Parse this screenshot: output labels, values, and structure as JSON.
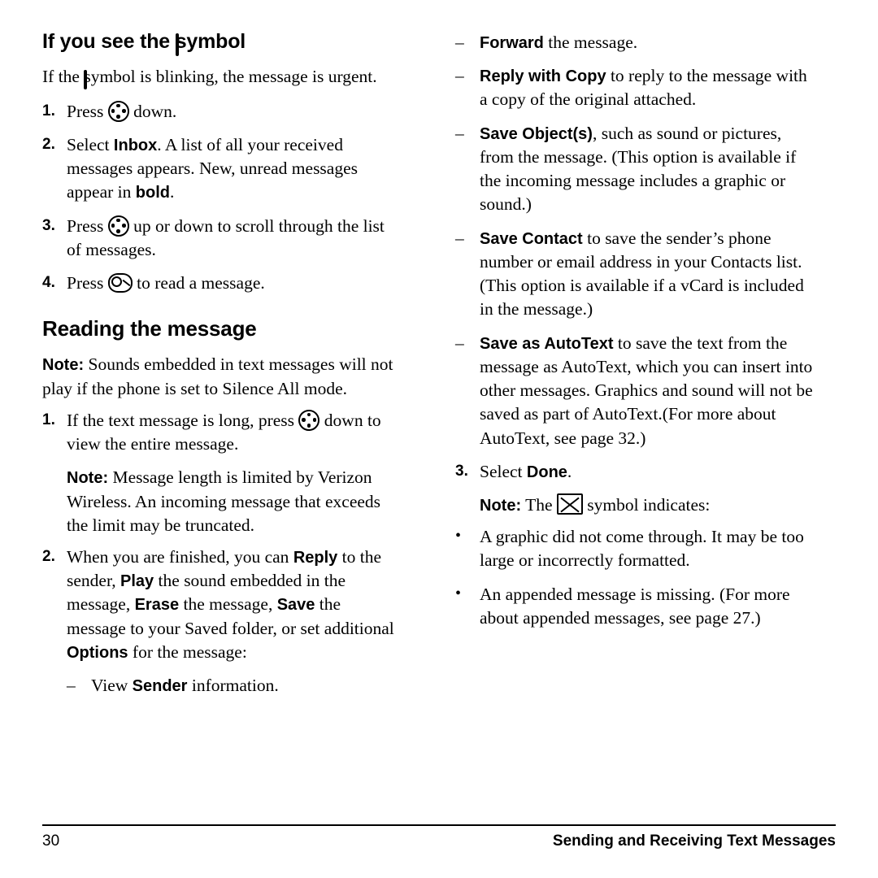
{
  "left": {
    "heading_pre": "If you see the",
    "heading_post": "symbol",
    "intro_pre": "If the",
    "intro_post": "symbol is blinking, the message is urgent.",
    "steps": [
      {
        "num": "1.",
        "pre": "Press",
        "post": "down."
      },
      {
        "num": "2.",
        "pre": "Select",
        "bold": "Inbox",
        "post": ". A list of all your received messages appears. New, unread messages appear in ",
        "bold2": "bold",
        "post2": "."
      },
      {
        "num": "3.",
        "pre": "Press",
        "post": "up or down to scroll through the list of messages."
      },
      {
        "num": "4.",
        "pre": "Press",
        "post": "to read a message."
      }
    ],
    "section2_heading": "Reading the message",
    "note1_label": "Note:",
    "note1_text": "Sounds embedded in text messages will not play if the phone is set to Silence All mode.",
    "step1_pre": "If the text message is long, press",
    "step1_post": "down to view the entire message.",
    "note2_label": "Note:",
    "note2_text": "Message length is limited by Verizon Wireless. An incoming message that exceeds the limit may be truncated.",
    "step2_num": "2.",
    "step2_a": "When you are finished, you can ",
    "step2_b_bold": "Reply",
    "step2_c": " to the sender, ",
    "step2_d_bold": "Play",
    "step2_e": " the sound embedded in the message, ",
    "step2_f_bold": "Erase",
    "step2_g": " the message, ",
    "step2_h_bold": "Save",
    "step2_i": " the message to your Saved folder, or set additional ",
    "step2_j_bold": "Options",
    "step2_k": " for the message:",
    "dash1_bold": "",
    "dash1_a": "View ",
    "dash1_b_bold": "Sender",
    "dash1_c": " information."
  },
  "right": {
    "dashes": [
      {
        "bold": "Forward",
        "text": " the message."
      },
      {
        "bold": "Reply with Copy",
        "text": " to reply to the message with a copy of the original attached."
      },
      {
        "bold": "Save Object(s)",
        "text": ", such as sound or pictures, from the message. (This option is available if the incoming message includes a graphic or sound.)"
      },
      {
        "bold": "Save Contact",
        "text": " to save the sender’s phone number or email address in your Contacts list. (This option is available if a vCard is included in the message.)"
      },
      {
        "bold": "Save as AutoText",
        "text": " to save the text from the message as AutoText, which you can insert into other messages. Graphics and sound will not be saved as part of AutoText.(For more about AutoText, see page 32.)"
      }
    ],
    "step3_num": "3.",
    "step3_pre": "Select ",
    "step3_bold": "Done",
    "step3_post": ".",
    "note_label": "Note:",
    "note_pre": "The",
    "note_post": "symbol indicates:",
    "bullets": [
      "A graphic did not come through. It may be too large or incorrectly formatted.",
      "An appended message is missing. (For more about appended messages, see page 27.)"
    ]
  },
  "footer": {
    "page_number": "30",
    "section_title": "Sending and Receiving Text Messages"
  },
  "icons": {
    "envelope": "envelope-icon",
    "navigation": "navigation-key-icon",
    "ok": "ok-key-icon",
    "broken_image": "broken-image-x-icon"
  }
}
